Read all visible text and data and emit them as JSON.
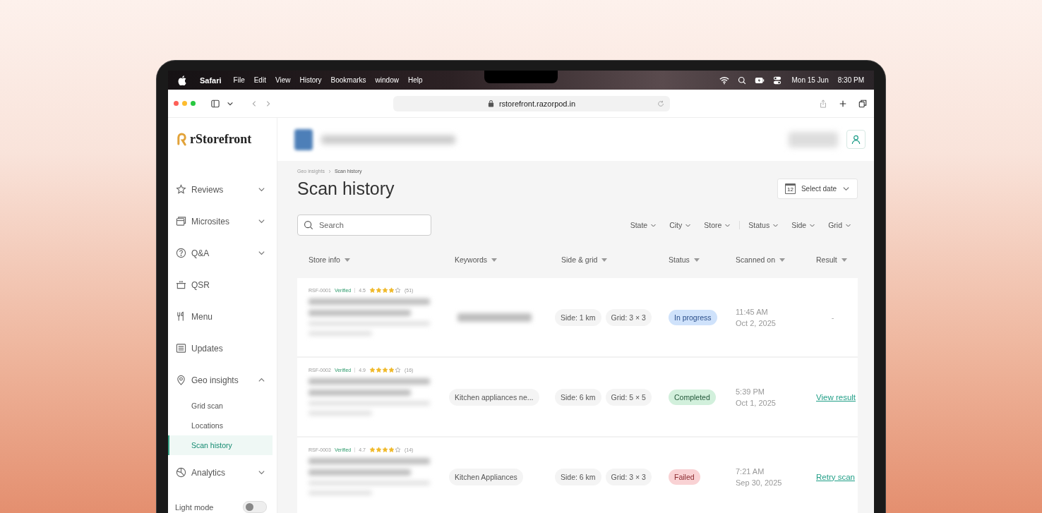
{
  "menubar": {
    "app": "Safari",
    "items": [
      "File",
      "Edit",
      "View",
      "History",
      "Bookmarks",
      "window",
      "Help"
    ],
    "date": "Mon 15 Jun",
    "time": "8:30 PM"
  },
  "browser": {
    "url": "rstorefront.razorpod.in"
  },
  "sidebar": {
    "logo": "rStorefront",
    "items": [
      {
        "label": "Reviews",
        "kind": "group",
        "expanded": false
      },
      {
        "label": "Microsites",
        "kind": "group",
        "expanded": false
      },
      {
        "label": "Q&A",
        "kind": "group",
        "expanded": false
      },
      {
        "label": "QSR",
        "kind": "link"
      },
      {
        "label": "Menu",
        "kind": "link"
      },
      {
        "label": "Updates",
        "kind": "link"
      },
      {
        "label": "Geo insights",
        "kind": "group",
        "expanded": true,
        "children": [
          {
            "label": "Grid scan",
            "selected": false
          },
          {
            "label": "Locations",
            "selected": false
          },
          {
            "label": "Scan history",
            "selected": true
          }
        ]
      },
      {
        "label": "Analytics",
        "kind": "group",
        "expanded": false
      }
    ],
    "light_mode": {
      "label": "Light mode",
      "on": false
    }
  },
  "breadcrumb": [
    "Geo insights",
    "Scan history"
  ],
  "title": "Scan history",
  "date_picker": {
    "label": "Select date",
    "icon_text": "12"
  },
  "search": {
    "placeholder": "Search"
  },
  "filter_groups": [
    [
      "State",
      "City",
      "Store"
    ],
    [
      "Status",
      "Side",
      "Grid"
    ]
  ],
  "columns": [
    "Store info",
    "Keywords",
    "Side & grid",
    "Status",
    "Scanned on",
    "Result"
  ],
  "rows": [
    {
      "id": "RSF-0001",
      "verified": "Verified",
      "rating": "4.5",
      "stars": 4,
      "count": "(51)",
      "side": "Side: 1 km",
      "grid": "Grid: 3 × 3",
      "status": {
        "label": "In progress",
        "kind": "in_progress"
      },
      "time": "11:45 AM",
      "date": "Oct 2, 2025",
      "result": {
        "label": "-",
        "kind": "text"
      }
    },
    {
      "id": "RSF-0002",
      "verified": "Verified",
      "rating": "4.9",
      "stars": 4,
      "count": "(16)",
      "keyword": "Kitchen appliances ne...",
      "side": "Side: 6 km",
      "grid": "Grid: 5 × 5",
      "status": {
        "label": "Completed",
        "kind": "completed"
      },
      "time": "5:39 PM",
      "date": "Oct 1, 2025",
      "result": {
        "label": "View result",
        "kind": "link"
      }
    },
    {
      "id": "RSF-0003",
      "verified": "Verified",
      "rating": "4.7",
      "stars": 4,
      "count": "(14)",
      "keyword": "Kitchen Appliances",
      "side": "Side: 6 km",
      "grid": "Grid: 3 × 3",
      "status": {
        "label": "Failed",
        "kind": "failed"
      },
      "time": "7:21 AM",
      "date": "Sep 30, 2025",
      "result": {
        "label": "Retry scan",
        "kind": "link"
      }
    }
  ]
}
